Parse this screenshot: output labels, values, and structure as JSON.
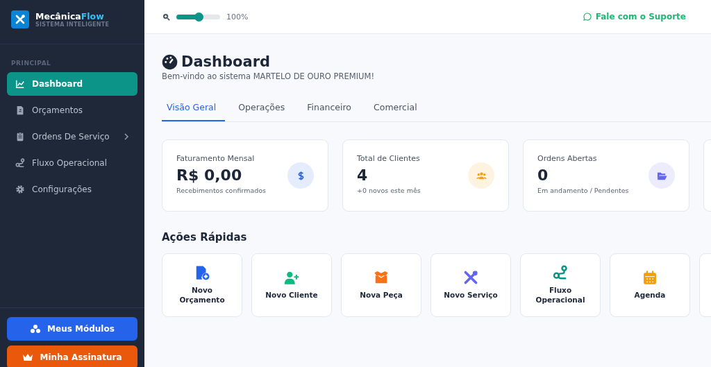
{
  "brand": {
    "name_first": "Mecânica",
    "name_second": "Flow",
    "tagline": "SISTEMA INTELIGENTE"
  },
  "sidebar": {
    "section": "PRINCIPAL",
    "items": [
      {
        "label": "Dashboard",
        "kind": "chart",
        "selected": true
      },
      {
        "label": "Orçamentos",
        "kind": "invoice",
        "selected": false
      },
      {
        "label": "Ordens De Serviço",
        "kind": "clipboard",
        "selected": false,
        "submenu": true
      },
      {
        "label": "Fluxo Operacional",
        "kind": "route",
        "selected": false
      },
      {
        "label": "Configurações",
        "kind": "gear",
        "selected": false
      }
    ],
    "buttons": [
      {
        "label": "Meus Módulos",
        "kind": "modules"
      },
      {
        "label": "Minha Assinatura",
        "kind": "subscription"
      }
    ]
  },
  "topbar": {
    "zoom": {
      "level": 0.5,
      "reading": "100%"
    },
    "support": "Fale com o Suporte"
  },
  "page": {
    "title": "Dashboard",
    "subtitle": "Bem-vindo ao sistema MARTELO DE OURO PREMIUM!"
  },
  "tabs": [
    {
      "label": "Visão Geral",
      "selected": true
    },
    {
      "label": "Operações",
      "selected": false
    },
    {
      "label": "Financeiro",
      "selected": false
    },
    {
      "label": "Comercial",
      "selected": false
    }
  ],
  "stats": [
    {
      "label": "Faturamento Mensal",
      "value": "R$ 0,00",
      "note": "Recebimentos confirmados",
      "kind": "dollar",
      "color": "#2563eb"
    },
    {
      "label": "Total de Clientes",
      "value": "4",
      "note": "+0 novos este mês",
      "kind": "users",
      "color": "#f59e0b"
    },
    {
      "label": "Ordens Abertas",
      "value": "0",
      "note": "Em andamento / Pendentes",
      "kind": "folder",
      "color": "#6366f1"
    }
  ],
  "quick_actions": {
    "title": "Ações Rápidas",
    "items": [
      {
        "label": "Novo Orçamento",
        "kind": "file-plus",
        "color": "#2563eb"
      },
      {
        "label": "Novo Cliente",
        "kind": "user-plus",
        "color": "#10b981"
      },
      {
        "label": "Nova Peça",
        "kind": "box",
        "color": "#f97316"
      },
      {
        "label": "Novo Serviço",
        "kind": "tools",
        "color": "#6366f1"
      },
      {
        "label": "Fluxo Operacional",
        "kind": "route",
        "color": "#0d9488"
      },
      {
        "label": "Agenda",
        "kind": "calendar",
        "color": "#f59e0b"
      }
    ]
  }
}
